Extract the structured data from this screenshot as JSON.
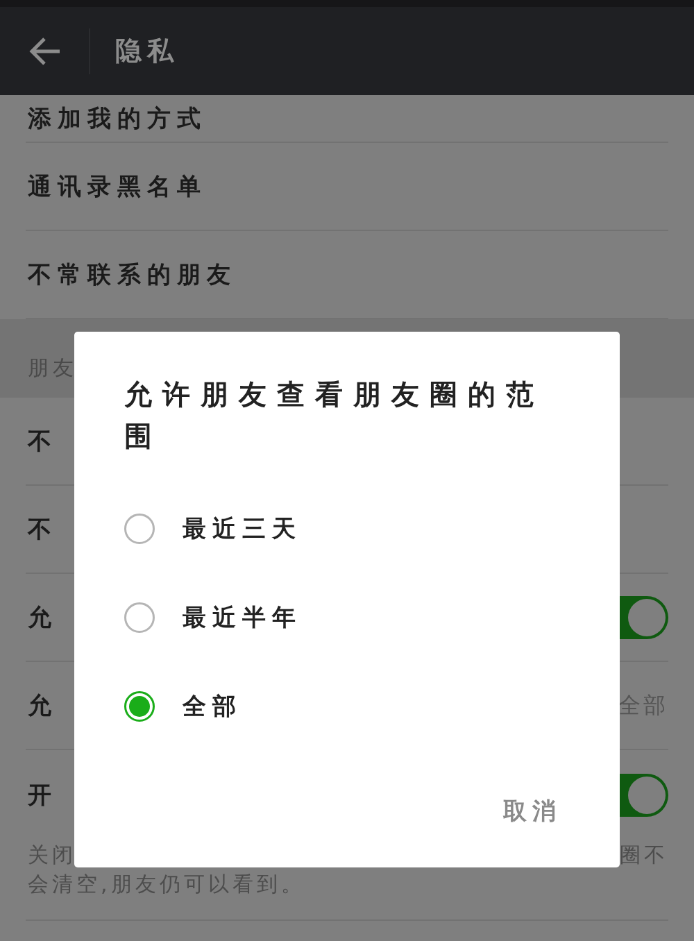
{
  "header": {
    "title": "隐私"
  },
  "settings": [
    {
      "kind": "row",
      "label": "添加我的方式"
    },
    {
      "kind": "row",
      "label": "通讯录黑名单"
    },
    {
      "kind": "row",
      "label": "不常联系的朋友"
    },
    {
      "kind": "section",
      "label": "朋友"
    },
    {
      "kind": "row",
      "label": "不"
    },
    {
      "kind": "row",
      "label": "不"
    },
    {
      "kind": "toggle",
      "label": "允",
      "on": true
    },
    {
      "kind": "value",
      "label": "允",
      "value": "全部"
    },
    {
      "kind": "toggle",
      "label": "开",
      "on": true,
      "note_left": "关闭",
      "note_right": "圈不",
      "note_line2": "会清空,朋友仍可以看到。"
    }
  ],
  "dialog": {
    "title": "允许朋友查看朋友圈的范围",
    "options": [
      {
        "label": "最近三天",
        "selected": false
      },
      {
        "label": "最近半年",
        "selected": false
      },
      {
        "label": "全部",
        "selected": true
      }
    ],
    "cancel": "取消"
  }
}
